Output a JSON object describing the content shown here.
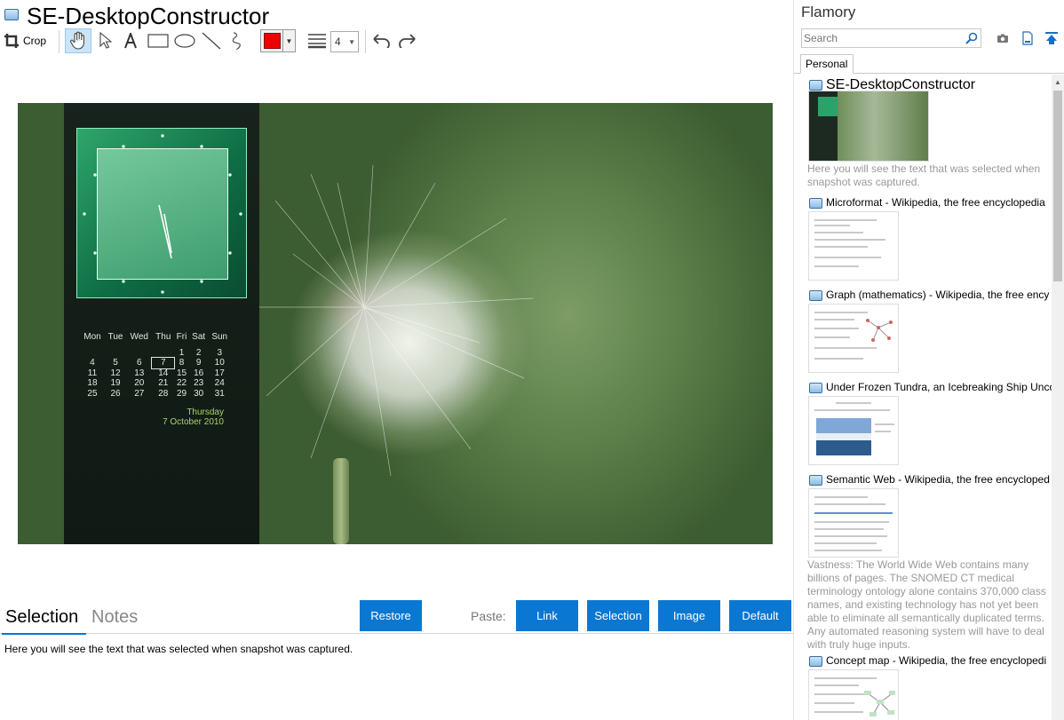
{
  "window": {
    "title": "SE-DesktopConstructor"
  },
  "toolbar": {
    "crop_label": "Crop",
    "tools": [
      "hand-icon",
      "pointer-icon",
      "text-icon",
      "rectangle-icon",
      "ellipse-icon",
      "line-icon",
      "freehand-icon"
    ],
    "color": "#ee0000",
    "line_width": "4",
    "undo": "undo-icon",
    "redo": "redo-icon"
  },
  "snapshot_widget": {
    "calendar": {
      "headers": [
        "Mon",
        "Tue",
        "Wed",
        "Thu",
        "Fri",
        "Sat",
        "Sun"
      ],
      "rows": [
        [
          "",
          "",
          "",
          "",
          "1",
          "2",
          "3"
        ],
        [
          "4",
          "5",
          "6",
          "7",
          "8",
          "9",
          "10"
        ],
        [
          "11",
          "12",
          "13",
          "14",
          "15",
          "16",
          "17"
        ],
        [
          "18",
          "19",
          "20",
          "21",
          "22",
          "23",
          "24"
        ],
        [
          "25",
          "26",
          "27",
          "28",
          "29",
          "30",
          "31"
        ]
      ],
      "today": "7",
      "weekday": "Thursday",
      "date": "7 October 2010"
    }
  },
  "tabs": {
    "selection": "Selection",
    "notes": "Notes"
  },
  "actions": {
    "restore": "Restore",
    "paste_label": "Paste:",
    "link": "Link",
    "selection": "Selection",
    "image": "Image",
    "default": "Default"
  },
  "selection_text": "Here you will see the text that was selected when snapshot was captured.",
  "sidebar": {
    "app_name": "Flamory",
    "search_placeholder": "Search",
    "tab": "Personal",
    "items": [
      {
        "title": "SE-DesktopConstructor",
        "desc": "Here you will see the text that was selected when snapshot was captured."
      },
      {
        "title": "Microformat - Wikipedia, the free encyclopedia"
      },
      {
        "title": "Graph (mathematics) - Wikipedia, the free ency"
      },
      {
        "title": "Under Frozen Tundra, an Icebreaking Ship Unco"
      },
      {
        "title": "Semantic Web - Wikipedia, the free encycloped",
        "desc": "Vastness: The World Wide Web contains many billions of pages. The SNOMED CT medical terminology ontology alone contains 370,000 class names, and existing technology has not yet been able to eliminate all semantically duplicated terms. Any automated reasoning system will have to deal with truly huge inputs."
      },
      {
        "title": "Concept map - Wikipedia, the free encyclopedi"
      }
    ]
  }
}
